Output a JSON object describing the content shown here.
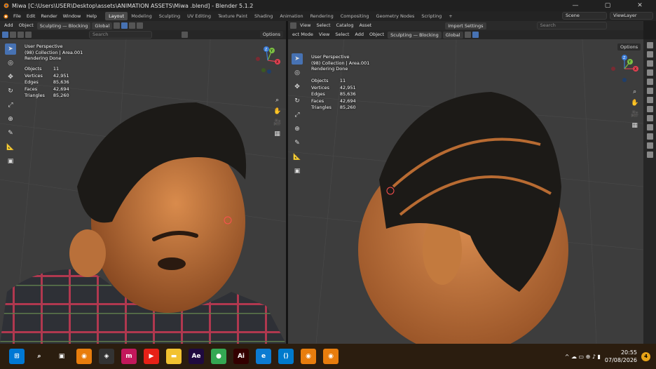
{
  "window": {
    "title": "Miwa  [C:\\Users\\USER\\Desktop\\assets\\ANIMATION ASSETS\\Miwa .blend] - Blender 5.1.2",
    "min": "—",
    "max": "▢",
    "close": "✕"
  },
  "menu": [
    "File",
    "Edit",
    "Render",
    "Window",
    "Help"
  ],
  "workspaces": [
    {
      "label": "Layout",
      "active": true
    },
    {
      "label": "Modeling"
    },
    {
      "label": "Sculpting"
    },
    {
      "label": "UV Editing"
    },
    {
      "label": "Texture Paint"
    },
    {
      "label": "Shading"
    },
    {
      "label": "Animation"
    },
    {
      "label": "Rendering"
    },
    {
      "label": "Compositing"
    },
    {
      "label": "Geometry Nodes"
    },
    {
      "label": "Scripting"
    },
    {
      "label": "+"
    }
  ],
  "scene": {
    "label": "Scene",
    "view_layer": "ViewLayer"
  },
  "left": {
    "header": [
      "Add",
      "Object"
    ],
    "mode": "Sculpting — Blocking",
    "orientation": "Global",
    "search_placeholder": "Search",
    "options": "Options",
    "info": [
      "User Perspective",
      "(98) Collection | Area.001",
      "Rendering Done"
    ],
    "stats": [
      [
        "Objects",
        "11"
      ],
      [
        "Vertices",
        "42,951"
      ],
      [
        "Edges",
        "85,636"
      ],
      [
        "Faces",
        "42,694"
      ],
      [
        "Triangles",
        "85,260"
      ]
    ]
  },
  "right": {
    "header": [
      "ect Mode",
      "View",
      "Select",
      "Add",
      "Object"
    ],
    "header_top": [
      "View",
      "Select",
      "Catalog",
      "Asset"
    ],
    "import": "Import Settings",
    "mode": "Sculpting — Blocking",
    "orientation": "Global",
    "search_placeholder": "Search",
    "options": "Options",
    "info": [
      "User Perspective",
      "(98) Collection | Area.001",
      "Rendering Done"
    ],
    "stats": [
      [
        "Objects",
        "11"
      ],
      [
        "Vertices",
        "42,951"
      ],
      [
        "Edges",
        "85,636"
      ],
      [
        "Faces",
        "42,694"
      ],
      [
        "Triangles",
        "85,260"
      ]
    ]
  },
  "gizmo": {
    "x": "X",
    "y": "Y",
    "z": "Z"
  },
  "taskbar": {
    "apps": [
      {
        "n": "start",
        "g": "⊞",
        "c": "#0078d4"
      },
      {
        "n": "search",
        "g": "⌕",
        "c": "transparent"
      },
      {
        "n": "task-view",
        "g": "▣",
        "c": "transparent"
      },
      {
        "n": "blender",
        "g": "◉",
        "c": "#e87d0d"
      },
      {
        "n": "davinci",
        "g": "◈",
        "c": "#333"
      },
      {
        "n": "app-m",
        "g": "m",
        "c": "#c2185b"
      },
      {
        "n": "youtube",
        "g": "▶",
        "c": "#e62117"
      },
      {
        "n": "explorer",
        "g": "▬",
        "c": "#f2c230"
      },
      {
        "n": "after-effects",
        "g": "Ae",
        "c": "#1f0a3f"
      },
      {
        "n": "chrome",
        "g": "●",
        "c": "#34a853"
      },
      {
        "n": "illustrator",
        "g": "Ai",
        "c": "#330000"
      },
      {
        "n": "edge",
        "g": "e",
        "c": "#0c7bd1"
      },
      {
        "n": "vscode",
        "g": "⟨⟩",
        "c": "#007acc"
      },
      {
        "n": "blender-2",
        "g": "◉",
        "c": "#e87d0d"
      },
      {
        "n": "blender-3",
        "g": "◉",
        "c": "#e87d0d"
      }
    ],
    "time": "20:55",
    "date": "07/08/2026",
    "notifications": "4",
    "tray": "^ ☁ ▭ ⊕ ♪ ▮"
  },
  "colors": {
    "accent": "#4772b3",
    "skin": "#c4793f",
    "hair": "#1c1a17",
    "shirt": "#2d2f35"
  }
}
